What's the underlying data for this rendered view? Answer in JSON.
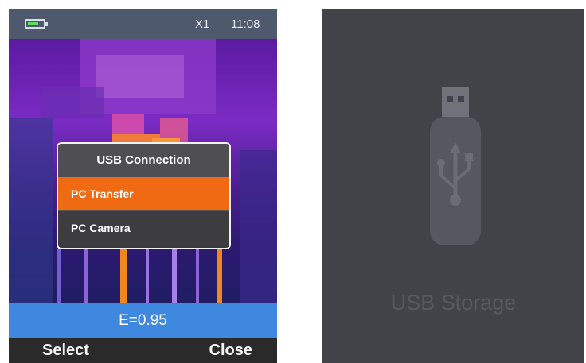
{
  "status_bar": {
    "zoom": "X1",
    "time": "11:08"
  },
  "usb_menu": {
    "title": "USB Connection",
    "items": [
      {
        "label": "PC Transfer",
        "selected": true
      },
      {
        "label": "PC Camera",
        "selected": false
      }
    ]
  },
  "emissivity": "E=0.95",
  "softkeys": {
    "left": "Select",
    "right": "Close"
  },
  "usb_storage": {
    "label": "USB Storage",
    "icon": "usb-drive-icon"
  },
  "colors": {
    "accent_selected": "#ef6a12",
    "emissivity_bar": "#3f88e0",
    "status_bar": "#4e596d",
    "right_screen_bg": "#414349"
  }
}
